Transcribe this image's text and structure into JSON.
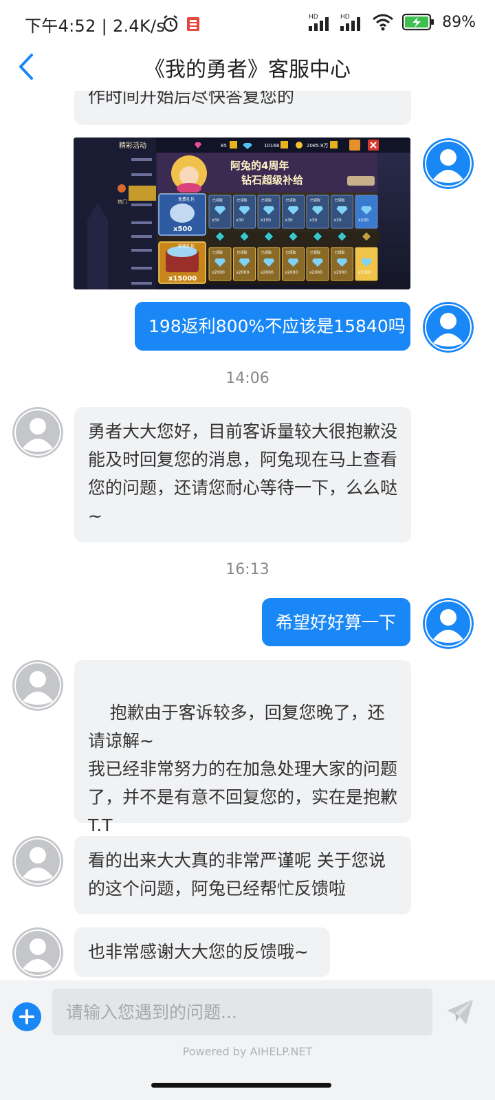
{
  "status_bar": {
    "time_speed": "下午4:52 | 2.4K/s",
    "battery_pct": "89%",
    "network_labels": [
      "HD",
      "HD"
    ],
    "icons": [
      "alarm-icon",
      "app-notification-icon",
      "signal-icon",
      "signal-icon",
      "wifi-icon",
      "battery-charging-icon"
    ]
  },
  "header": {
    "title": "《我的勇者》客服中心",
    "back_icon": "chevron-left-icon"
  },
  "colors": {
    "accent": "#1a87f6",
    "incoming_bubble": "#f1f2f4",
    "outgoing_text": "#ffffff"
  },
  "messages": [
    {
      "from": "agent",
      "text": "作时间开始后尽快答复您的"
    },
    {
      "from": "user",
      "type": "image",
      "image": {
        "menu_title": "精彩活动",
        "currency_pink": "85",
        "currency_diamond": "10168",
        "currency_gold": "2085.9万",
        "banner_line1": "阿兔的4周年",
        "banner_line2": "钻石超级补给",
        "tab_label": "热门",
        "free_label": "免费礼包",
        "free_count": "x500",
        "paid_label": "超值礼包",
        "paid_count": "x15000",
        "claimed_label": "已领取",
        "row1_counts": [
          "x30",
          "x30",
          "x150",
          "x30",
          "x30",
          "x30",
          "x200"
        ],
        "row2_counts": [
          "x2000",
          "x2000",
          "x2000",
          "x2000",
          "x2000",
          "x2000",
          "x3000"
        ]
      }
    },
    {
      "from": "user",
      "text": "198返利800%不应该是15840吗"
    },
    {
      "type": "timestamp",
      "text": "14:06"
    },
    {
      "from": "agent",
      "text": "勇者大大您好，目前客诉量较大很抱歉没能及时回复您的消息，阿兔现在马上查看您的问题，还请您耐心等待一下，么么哒~"
    },
    {
      "type": "timestamp",
      "text": "16:13"
    },
    {
      "from": "user",
      "text": "希望好好算一下"
    },
    {
      "from": "agent",
      "text": "抱歉由于客诉较多，回复您晚了，还请谅解~\n我已经非常努力的在加急处理大家的问题了，并不是有意不回复您的，实在是抱歉T.T"
    },
    {
      "from": "agent",
      "text": "看的出来大大真的非常严谨呢  关于您说的这个问题，阿兔已经帮忙反馈啦"
    },
    {
      "from": "agent",
      "text": "也非常感谢大大您的反馈哦~"
    }
  ],
  "input": {
    "placeholder": "请输入您遇到的问题...",
    "value": ""
  },
  "footer": {
    "powered_by": "Powered by AIHELP.NET"
  }
}
